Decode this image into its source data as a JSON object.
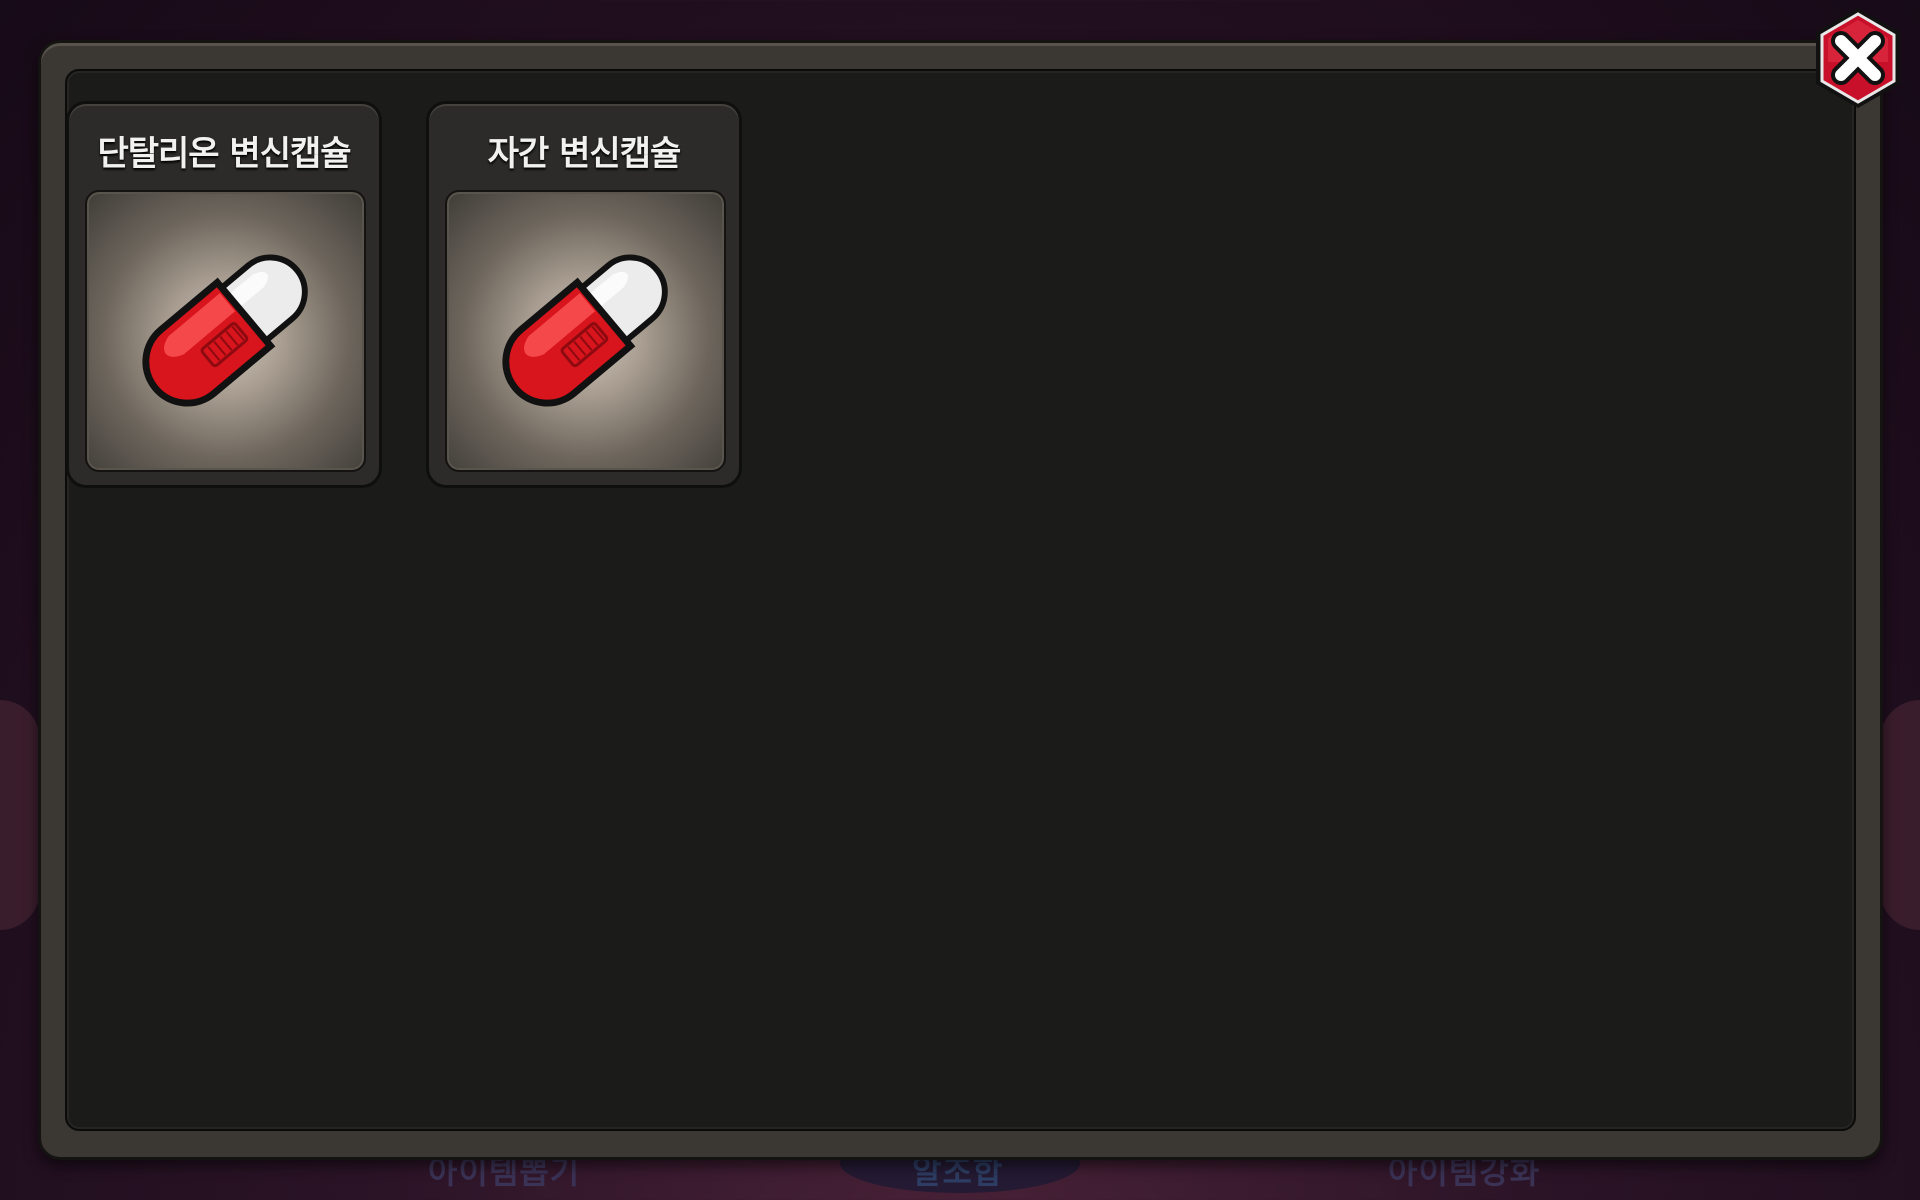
{
  "background": {
    "menu": [
      "아이템뽑기",
      "알조합",
      "아이템강화"
    ]
  },
  "inventory": {
    "items": [
      {
        "name": "단탈리온 변신캡슐",
        "icon": "red-capsule-icon"
      },
      {
        "name": "자간 변신캡슐",
        "icon": "red-capsule-icon"
      }
    ]
  },
  "colors": {
    "capsule_red": "#d8141c",
    "capsule_white": "#eeeeee",
    "close_red": "#c8102a"
  },
  "close_button": {
    "icon": "close-icon"
  }
}
